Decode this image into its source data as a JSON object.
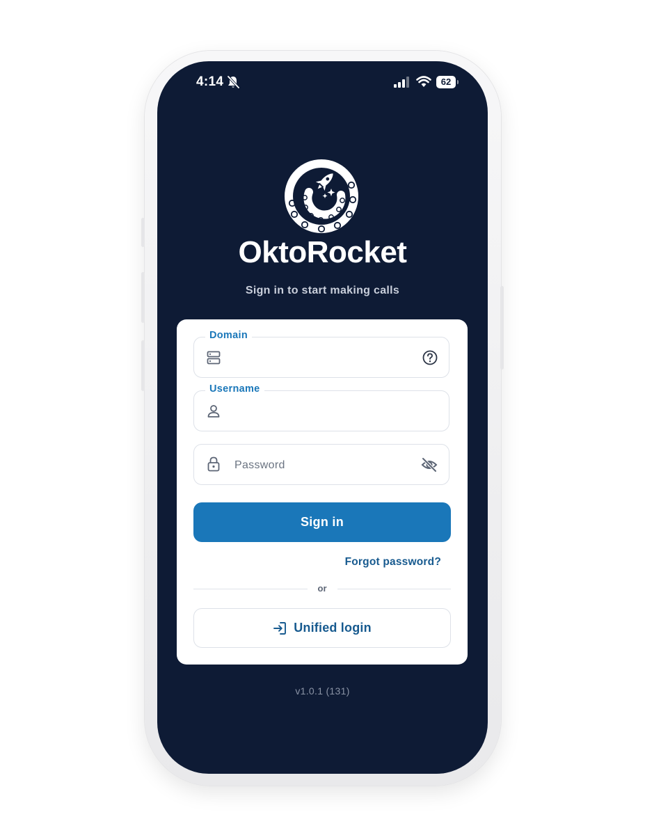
{
  "status_bar": {
    "time": "4:14",
    "battery": "62",
    "icons": [
      "bell-slash-icon",
      "cellular-signal-icon",
      "wifi-icon",
      "battery-icon"
    ]
  },
  "brand": {
    "name": "OktoRocket",
    "tagline": "Sign in to start making calls",
    "logo_icon": "oktorocket-logo-icon"
  },
  "form": {
    "domain": {
      "label": "Domain",
      "value": "",
      "icon": "server-icon",
      "help_icon": "question-circle-icon"
    },
    "username": {
      "label": "Username",
      "value": "",
      "icon": "user-icon"
    },
    "password": {
      "placeholder": "Password",
      "value": "",
      "icon": "lock-icon",
      "toggle_icon": "eye-slash-icon"
    },
    "sign_in_label": "Sign in",
    "forgot_password_label": "Forgot password?",
    "divider_label": "or",
    "unified_login_label": "Unified login",
    "unified_login_icon": "login-arrow-icon"
  },
  "version": "v1.0.1 (131)",
  "colors": {
    "background": "#0e1b35",
    "accent": "#1a77b9",
    "link": "#175a8f",
    "card": "#ffffff"
  }
}
